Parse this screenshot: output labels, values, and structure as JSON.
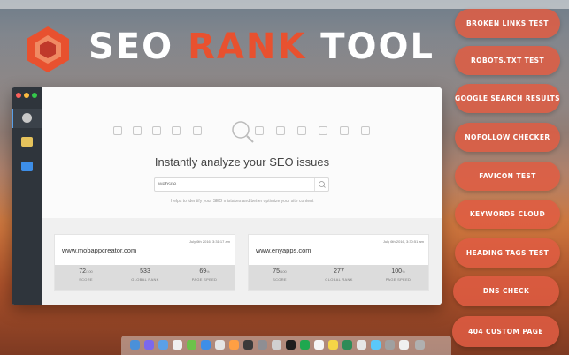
{
  "header": {
    "title_part1": "SEO",
    "title_accent": "RANK",
    "title_part2": "TOOL",
    "accent_color": "#e8512f"
  },
  "hero": {
    "title": "Instantly analyze your SEO issues",
    "search_placeholder": "website",
    "subtitle": "Helps to identify your SEO mistakes and better optimize your site content"
  },
  "results": [
    {
      "site": "www.mobappcreator.com",
      "date": "July 6th 2016, 3:31:17 am",
      "score": "72",
      "score_suffix": "/100",
      "global_rank": "533",
      "page_speed": "69",
      "page_speed_suffix": "%"
    },
    {
      "site": "www.enyapps.com",
      "date": "July 6th 2016, 3:30:51 am",
      "score": "75",
      "score_suffix": "/100",
      "global_rank": "277",
      "page_speed": "100",
      "page_speed_suffix": "%"
    }
  ],
  "stat_labels": {
    "score": "SCORE",
    "global_rank": "GLOBAL RANK",
    "page_speed": "PAGE SPEED"
  },
  "features": [
    "BROKEN LINKS TEST",
    "ROBOTS.TXT TEST",
    "GOOGLE SEARCH RESULTS",
    "NOFOLLOW CHECKER",
    "FAVICON TEST",
    "KEYWORDS CLOUD",
    "HEADING TAGS TEST",
    "DNS CHECK",
    "404 CUSTOM PAGE"
  ],
  "sidebar": {
    "icons": [
      "seo-globe-icon",
      "mail-icon",
      "envelope-icon"
    ]
  }
}
